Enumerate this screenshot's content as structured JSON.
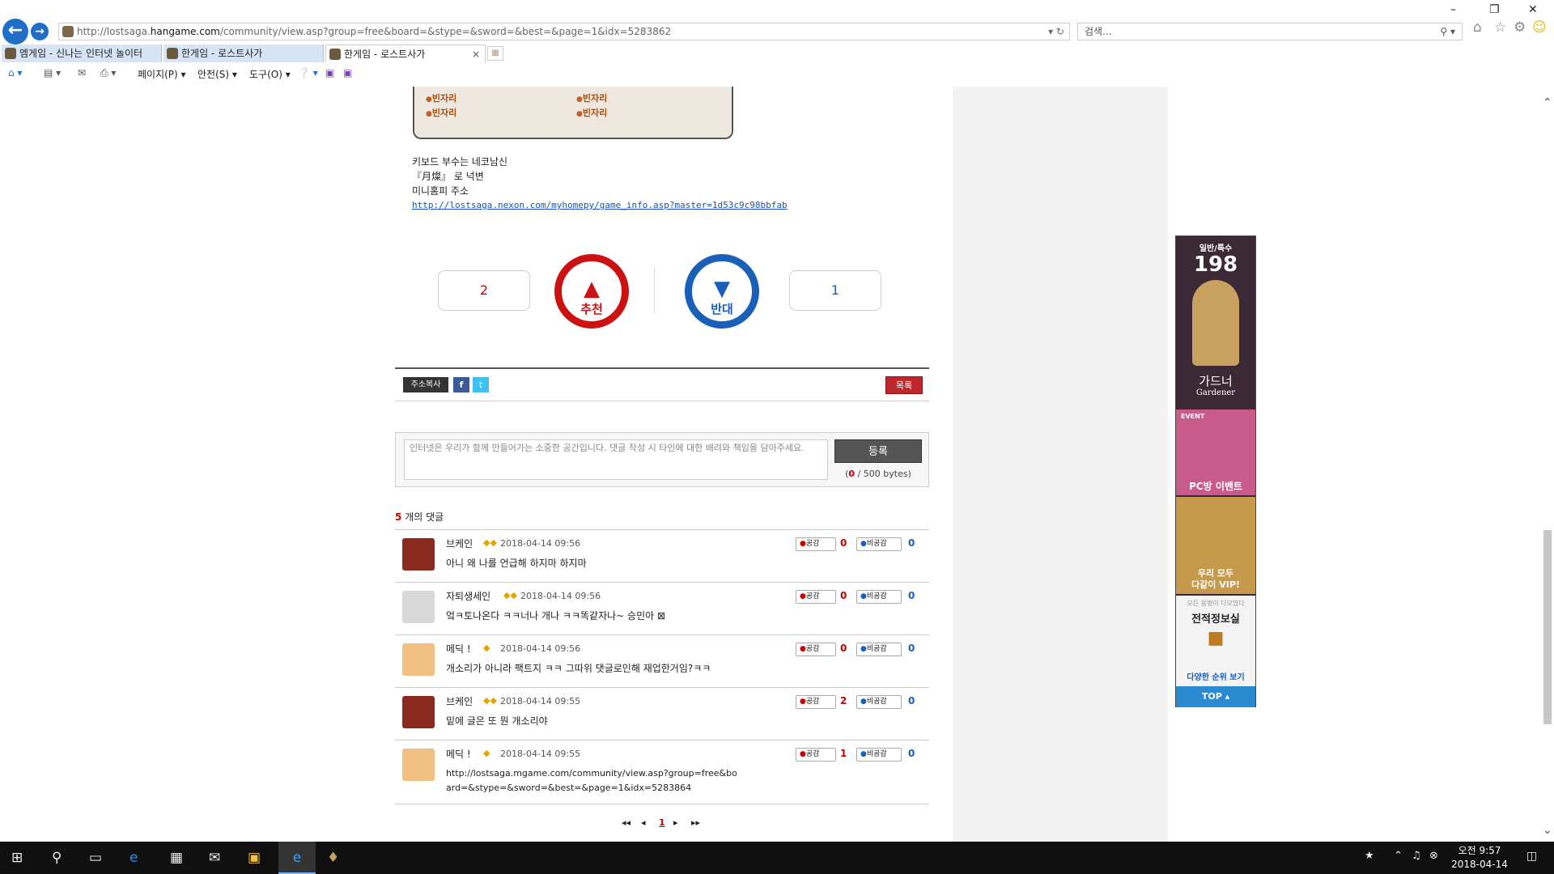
{
  "browser": {
    "url_prefix": "http://lostsaga.",
    "url_host": "hangame.com",
    "url_rest": "/community/view.asp?group=free&board=&stype=&sword=&best=&page=1&idx=5283862",
    "search_placeholder": "검색...",
    "tabs": [
      "엠게임 - 신나는 인터넷 놀이터",
      "한게임 - 로스트사가",
      "한게임 - 로스트사가"
    ],
    "menu": {
      "page": "페이지(P)",
      "safety": "안전(S)",
      "tools": "도구(O)"
    }
  },
  "post": {
    "seats": [
      "빈자리",
      "빈자리",
      "빈자리",
      "빈자리"
    ],
    "signature_lines": [
      "키보드 부수는 네코남신",
      "『月燦』 로 넉변",
      "미니홈피 주소"
    ],
    "signature_link": "http://lostsaga.nexon.com/myhomepy/game_info.asp?master=1d53c9c98bbfab",
    "recommend_label": "추천",
    "recommend_count": "2",
    "oppose_label": "반대",
    "oppose_count": "1",
    "copy_button": "주소복사",
    "facebook": "f",
    "twitter": "t",
    "list_button": "목록"
  },
  "comment_form": {
    "placeholder": "인터넷은 우리가 함께 만들어가는 소중한 공간입니다. 댓글 작성 시 타인에 대한 배려와 책임을 담아주세요.",
    "submit": "등록",
    "bytes_current": "0",
    "bytes_rest": " / 500 bytes)",
    "bytes_open": "("
  },
  "comments_header": {
    "count": "5",
    "suffix": " 개의 댓글"
  },
  "comments": [
    {
      "nick": "브케인",
      "date": "2018-04-14 09:56",
      "text": "아니 왜 나를 언급해 하지마 하지마",
      "like_label": "공감",
      "likes": "0",
      "dislike_label": "비공감",
      "dislikes": "0"
    },
    {
      "nick": "자퇴생세인",
      "date": "2018-04-14 09:56",
      "text": "엌ㅋ토나온다 ㅋㅋ너나 개나 ㅋㅋ똑같자나~ 승민아 ⊠",
      "like_label": "공감",
      "likes": "0",
      "dislike_label": "비공감",
      "dislikes": "0"
    },
    {
      "nick": "메딕 !",
      "date": "2018-04-14 09:56",
      "text": "개소리가 아니라 팩트지 ㅋㅋ 그따위 댓글로인해 재업한거임?ㅋㅋ",
      "like_label": "공감",
      "likes": "0",
      "dislike_label": "비공감",
      "dislikes": "0"
    },
    {
      "nick": "브케인",
      "date": "2018-04-14 09:55",
      "text": "밑에 글은 또 뭔 개소리야",
      "like_label": "공감",
      "likes": "2",
      "dislike_label": "비공감",
      "dislikes": "0"
    },
    {
      "nick": "메딕 !",
      "date": "2018-04-14 09:55",
      "text": "http://lostsaga.mgame.com/community/view.asp?group=free&board=&stype=&sword=&best=&page=1&idx=5283864",
      "like_label": "공감",
      "likes": "1",
      "dislike_label": "비공감",
      "dislikes": "0"
    }
  ],
  "pagination": {
    "first": "◂◂",
    "prev": "◂",
    "current": "1",
    "next": "▸",
    "last": "▸▸"
  },
  "banner": {
    "tag": "일반/특수",
    "number": "198",
    "name_ko": "가드너",
    "name_en": "Gardener",
    "event_badge": "EVENT",
    "pcbang": "PC방 이벤트",
    "vip_line1": "우리 모두",
    "vip_line2": "다같이 VIP!",
    "rank_top": "모든 용병이 다모였다",
    "rank_title": "전적정보실",
    "rank_link": "다양한 순위 보기",
    "top": "TOP ▴"
  },
  "taskbar": {
    "time": "오전 9:57",
    "date": "2018-04-14"
  }
}
